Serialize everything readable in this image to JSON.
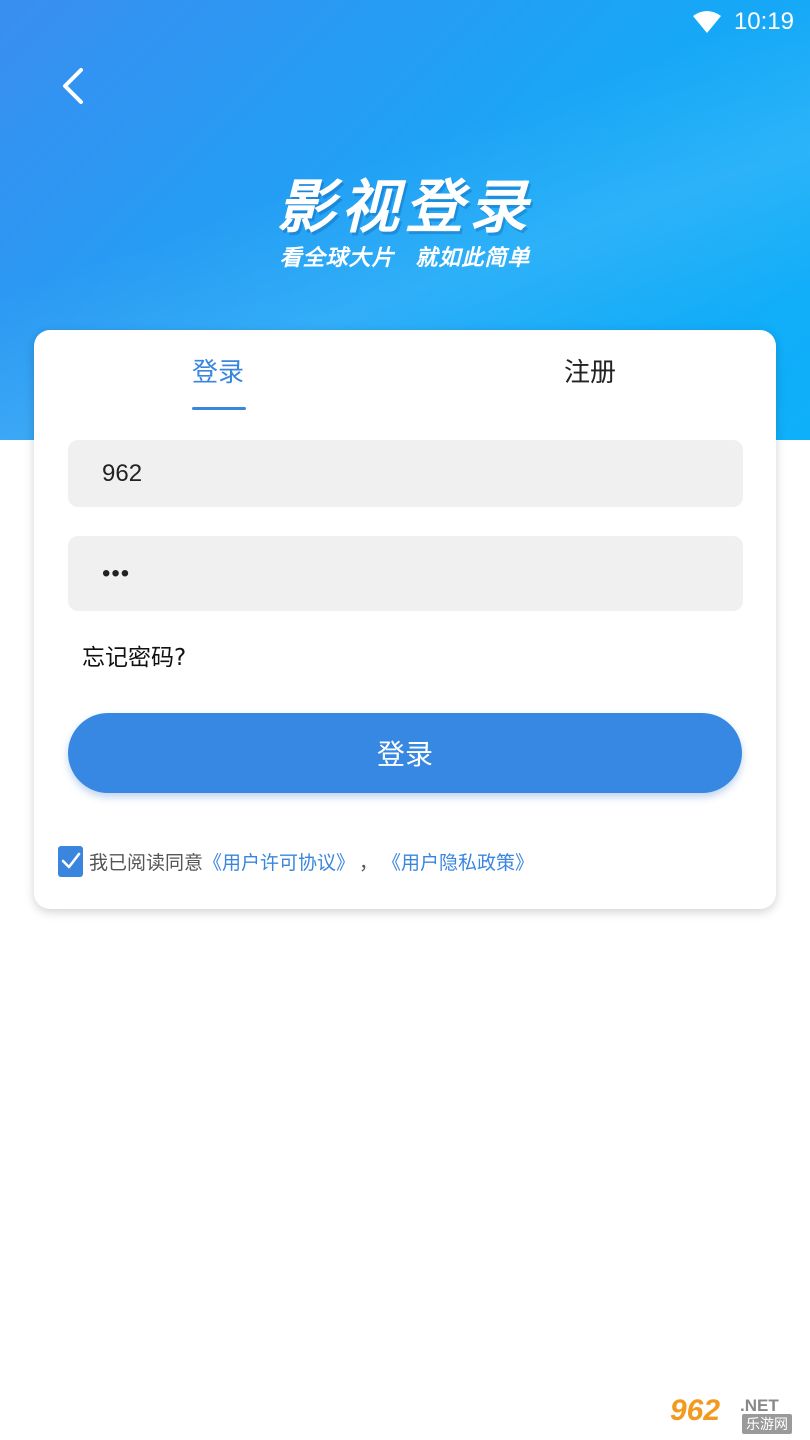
{
  "status_bar": {
    "time": "10:19",
    "wifi_icon": "wifi-icon"
  },
  "hero": {
    "back_icon": "chevron-left-icon",
    "title": "影视登录",
    "subtitle": "看全球大片 就如此简单"
  },
  "tabs": [
    {
      "label": "登录",
      "active": true
    },
    {
      "label": "注册",
      "active": false
    }
  ],
  "form": {
    "username_value": "962",
    "password_value": "•••",
    "forgot_label": "忘记密码?",
    "login_button_label": "登录"
  },
  "agreement": {
    "checked": true,
    "prefix": "我已阅读同意",
    "user_agreement": "《用户许可协议》",
    "separator": "，",
    "privacy_policy": "《用户隐私政策》"
  },
  "watermark": {
    "number": "962",
    "net": ".NET",
    "tag": "乐游网"
  },
  "colors": {
    "accent": "#3a86de",
    "button": "#3688e2",
    "hero_start": "#3a8ef0",
    "hero_end": "#0fb0fa"
  }
}
